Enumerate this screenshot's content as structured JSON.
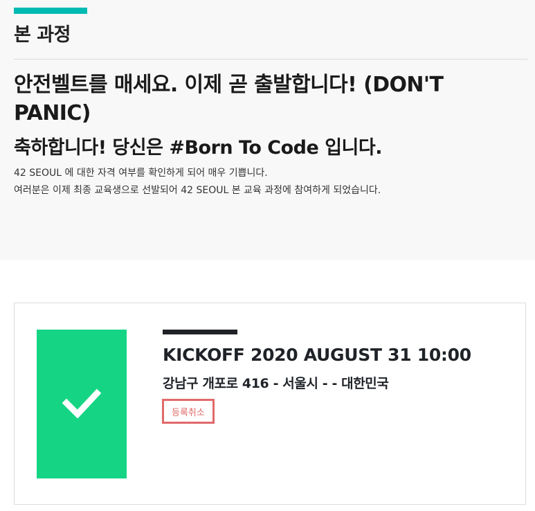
{
  "header": {
    "section_title": "본 과정",
    "headline": "안전벨트를 매세요. 이제 곧 출발합니다! (DON'T PANIC)",
    "subheadline": "축하합니다! 당신은 #Born To Code 입니다.",
    "body_lines": [
      "42 SEOUL 에 대한 자격 여부를 확인하게 되어 매우 기쁩니다.",
      "여러분은 이제 최종 교육생으로 선발되어 42 SEOUL 본 교육 과정에 참여하게 되었습니다."
    ]
  },
  "event": {
    "status_icon": "checkmark-icon",
    "title": "KICKOFF 2020 AUGUST 31  10:00",
    "location": "강남구 개포로 416 - 서울시 - - 대한민국",
    "cancel_label": "등록취소"
  },
  "colors": {
    "accent": "#00bab3",
    "success": "#15d584",
    "danger": "#e06969",
    "dark": "#1f2328"
  }
}
